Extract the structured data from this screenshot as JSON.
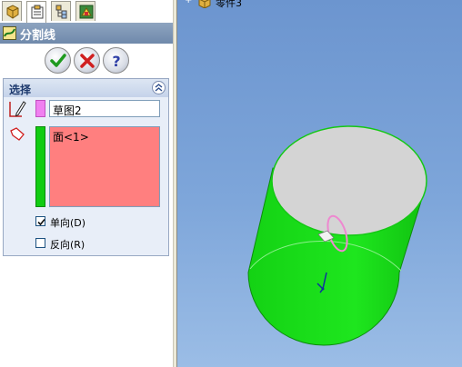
{
  "property_manager": {
    "tabs": [
      "feature-manager-icon",
      "property-manager-icon",
      "configuration-manager-icon",
      "dimxpert-icon"
    ],
    "title": "分割线",
    "buttons": {
      "ok": "ok-icon",
      "cancel": "cancel-icon",
      "help": "help-icon"
    },
    "selection": {
      "title": "选择",
      "sketch_value": "草图2",
      "faces": [
        "面<1>"
      ],
      "options": [
        {
          "label": "单向(D)",
          "checked": true
        },
        {
          "label": "反向(R)",
          "checked": false
        }
      ]
    }
  },
  "viewport": {
    "tree_item_label": "零件3",
    "model": {
      "body_color": "#12d812",
      "top_face_color": "#d4d4d4"
    }
  }
}
